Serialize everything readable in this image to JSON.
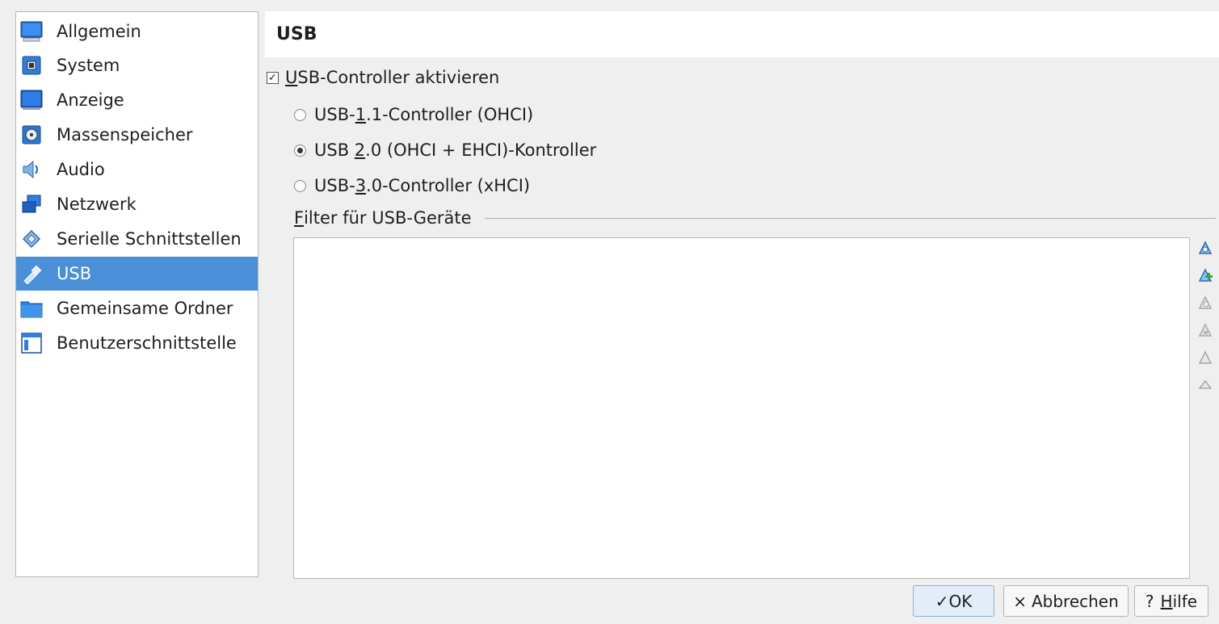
{
  "sidebar": {
    "items": [
      {
        "label": "Allgemein",
        "icon": "general-monitor-icon"
      },
      {
        "label": "System",
        "icon": "system-chip-icon"
      },
      {
        "label": "Anzeige",
        "icon": "display-monitor-icon"
      },
      {
        "label": "Massenspeicher",
        "icon": "storage-disk-icon"
      },
      {
        "label": "Audio",
        "icon": "audio-speaker-icon"
      },
      {
        "label": "Netzwerk",
        "icon": "network-icon"
      },
      {
        "label": "Serielle Schnittstellen",
        "icon": "serial-port-icon"
      },
      {
        "label": "USB",
        "icon": "usb-icon",
        "selected": true
      },
      {
        "label": "Gemeinsame Ordner",
        "icon": "shared-folder-icon"
      },
      {
        "label": "Benutzerschnittstelle",
        "icon": "user-interface-icon"
      }
    ]
  },
  "header": {
    "title": "USB"
  },
  "usb": {
    "enable_prefix": "U",
    "enable_rest": "SB-Controller aktivieren",
    "enabled": true,
    "options": [
      {
        "pre": "USB-",
        "key": "1",
        "post": ".1-Controller (OHCI)",
        "selected": false
      },
      {
        "pre": "USB ",
        "key": "2",
        "post": ".0 (OHCI + EHCI)-Kontroller",
        "selected": true
      },
      {
        "pre": "USB-",
        "key": "3",
        "post": ".0-Controller (xHCI)",
        "selected": false
      }
    ]
  },
  "filter": {
    "title_key": "F",
    "title_rest": "ilter für USB-Geräte",
    "toolbar": [
      {
        "icon": "add-empty-filter-icon",
        "enabled": true
      },
      {
        "icon": "add-filter-from-device-icon",
        "enabled": true
      },
      {
        "icon": "edit-filter-icon",
        "enabled": false
      },
      {
        "icon": "remove-filter-icon",
        "enabled": false
      },
      {
        "icon": "move-filter-up-icon",
        "enabled": false
      },
      {
        "icon": "move-filter-down-icon",
        "enabled": false
      }
    ]
  },
  "buttons": {
    "ok_glyph": "✓",
    "ok": "OK",
    "cancel_glyph": "×",
    "cancel": "Abbrechen",
    "help_glyph": "?",
    "help_key": "H",
    "help_rest": "ilfe"
  },
  "colors": {
    "selection": "#4a90d9",
    "accent": "#2c7ac9"
  }
}
